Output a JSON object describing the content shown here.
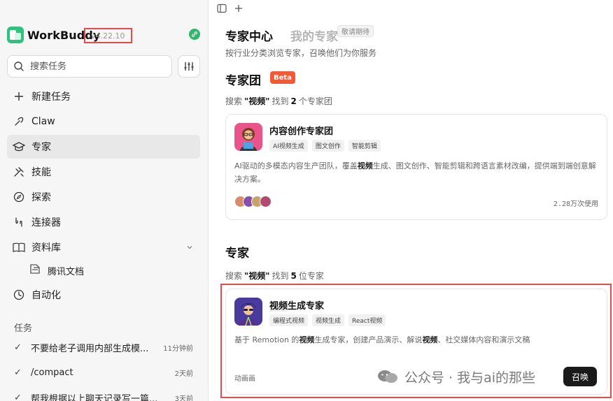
{
  "brand": {
    "name": "WorkBuddy",
    "version": "v4.22.10"
  },
  "search": {
    "placeholder": "搜索任务"
  },
  "nav": {
    "new_task": "新建任务",
    "claw": "Claw",
    "experts": "专家",
    "skills": "技能",
    "explore": "探索",
    "connectors": "连接器",
    "library": "资料库",
    "tencent_docs": "腾讯文档",
    "automation": "自动化"
  },
  "tasks": {
    "section_label": "任务",
    "items": [
      {
        "label": "不要给老子调用内部生成模...",
        "time": "11分钟前"
      },
      {
        "label": "/compact",
        "time": "2天前"
      },
      {
        "label": "帮我根据以上聊天记录写一篇...",
        "time": "3天前"
      }
    ]
  },
  "header": {
    "expert_center": "专家中心",
    "my_experts": "我的专家",
    "coming_soon": "敬请期待",
    "subtitle": "按行业分类浏览专家，召唤他们为你服务"
  },
  "team_section": {
    "title": "专家团",
    "badge": "Beta",
    "result_prefix": "搜索",
    "query": "\"视频\"",
    "result_mid": "找到",
    "count": "2",
    "result_suffix": "个专家团"
  },
  "team_card": {
    "title": "内容创作专家团",
    "tags": [
      "AI视频生成",
      "图文创作",
      "智能剪辑"
    ],
    "desc_before": "AI驱动的多模态内容生产团队，覆盖",
    "desc_highlight": "视频",
    "desc_after": "生成、图文创作、智能剪辑和跨语言素材改编，提供端到端创意解决方案。",
    "usage": "2.28万次使用"
  },
  "expert_section": {
    "title": "专家",
    "result_prefix": "搜索",
    "query": "\"视频\"",
    "result_mid": "找到",
    "count": "5",
    "result_suffix": "位专家"
  },
  "expert_card": {
    "title_highlight": "视频",
    "title_rest": "生成专家",
    "tags": [
      "编程式视频",
      "视频生成",
      "React视频"
    ],
    "desc_1": "基于 Remotion 的",
    "desc_h1": "视频",
    "desc_2": "生成专家，创建产品演示、解说",
    "desc_h2": "视频",
    "desc_3": "、社交媒体内容和演示文稿",
    "category": "动画画",
    "summon_label": "召唤"
  },
  "watermark": {
    "text": "公众号 · 我与ai的那些"
  },
  "colors": {
    "accent_red": "#e84a4a",
    "beta_orange": "#f25a37",
    "brand_green": "#2ec27e",
    "summon_bg": "#1a1a1a"
  }
}
